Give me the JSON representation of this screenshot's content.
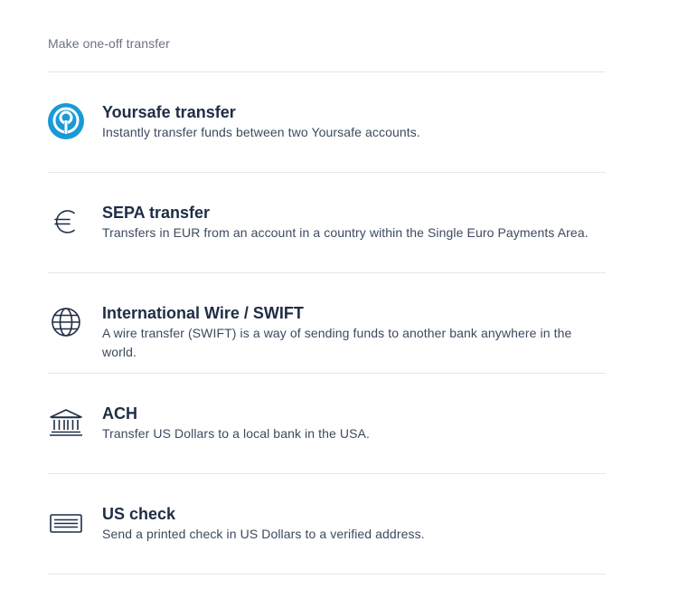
{
  "section": {
    "title": "Make one-off transfer"
  },
  "options": [
    {
      "icon": "yoursafe-logo-icon",
      "title": "Yoursafe transfer",
      "description": "Instantly transfer funds between two Yoursafe accounts."
    },
    {
      "icon": "euro-icon",
      "title": "SEPA transfer",
      "description": "Transfers in EUR from an account in a country within the Single Euro Payments Area."
    },
    {
      "icon": "globe-icon",
      "title": "International Wire / SWIFT",
      "description": "A wire transfer (SWIFT) is a way of sending funds to another bank anywhere in the world."
    },
    {
      "icon": "bank-icon",
      "title": "ACH",
      "description": "Transfer US Dollars to a local bank in the USA."
    },
    {
      "icon": "check-icon",
      "title": "US check",
      "description": "Send a printed check in US Dollars to a verified address."
    }
  ],
  "colors": {
    "brand": "#1a9ad6",
    "text": "#1f2d45",
    "muted": "#6b7280",
    "divider": "#e3e6ea"
  }
}
